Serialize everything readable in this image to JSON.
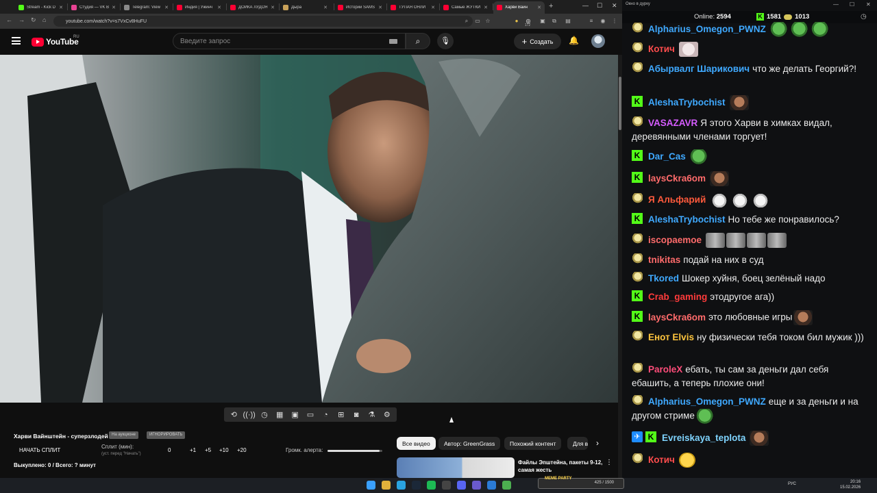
{
  "browser": {
    "tabs": [
      {
        "label": "Stream - Kick D",
        "icon": "kick-icon",
        "color": "#53fc18"
      },
      {
        "label": "Студия — VK B",
        "icon": "vk-icon",
        "color": "#e84393"
      },
      {
        "label": "Telegram: View",
        "icon": "telegram-icon",
        "color": "#8a8a8a"
      },
      {
        "label": "Индия | Ужинч",
        "icon": "youtube-icon",
        "color": "#ff0033"
      },
      {
        "label": "ДОЙКА ЛУДОЯ",
        "icon": "youtube-icon",
        "color": "#ff0033"
      },
      {
        "label": "Дыра",
        "icon": "page-icon",
        "color": "#c9a25a"
      },
      {
        "label": "Истории SAMS",
        "icon": "youtube-icon",
        "color": "#ff0033"
      },
      {
        "label": "ТУПАЯ ОНЛИ",
        "icon": "youtube-icon",
        "color": "#ff0033"
      },
      {
        "label": "Самые ЖУТКИ",
        "icon": "youtube-icon",
        "color": "#ff0033"
      },
      {
        "label": "Харви Вайн",
        "icon": "youtube-icon",
        "color": "#ff0033"
      }
    ],
    "url": "youtube.com/watch?v=s7VxCv8HuFU",
    "ext_badge_1": "172"
  },
  "youtube": {
    "logo_text": "YouTube",
    "country_code": "RU",
    "search_placeholder": "Введите запрос",
    "create_label": "Создать"
  },
  "player_controls": [
    "loop-icon",
    "broadcast-icon",
    "watch-later-icon",
    "clapper-icon",
    "miniplayer-icon",
    "theater-icon",
    "speed-icon",
    "add-screen-icon",
    "camera-icon",
    "flask-icon",
    "gear-icon"
  ],
  "splitter": {
    "title": "Харви Вайнштейн - суперзлодей",
    "badge_1": "На аукционе",
    "badge_2": "ИГНОРИРОВАТЬ",
    "start_split": "НАЧАТЬ СПЛИТ",
    "split_minutes": "Сплит (мин):",
    "split_note": "(уст. перед \"Начать\")",
    "value": "0",
    "steps": [
      "+1",
      "+5",
      "+10",
      "+20"
    ],
    "alert_volume_label": "Громк. алерта:",
    "alert_volume": 0.95,
    "bought": "Выкуплено: 0 / Всего: ? минут"
  },
  "chips": [
    "Все видео",
    "Автор: GreenGrass",
    "Похожий контент",
    "Для в"
  ],
  "recommendation": {
    "title": "Файлы Эпштейна, пакеты 9-12, самая жесть"
  },
  "chat": {
    "window_title": "Окно в дурку",
    "online_label": "Online:",
    "online_count": "2594",
    "kick_count": "1581",
    "coin_count": "1013",
    "messages": [
      {
        "badge": "coin",
        "user": "Alpharius_Omegon_PWNZ",
        "color": "#3fa9ff",
        "text": "",
        "emotes": [
          "frog",
          "frog",
          "frog"
        ]
      },
      {
        "badge": "coin",
        "user": "Котич",
        "color": "#ff4d4d",
        "text": "",
        "emotes": [
          "cat"
        ]
      },
      {
        "badge": "coin",
        "user": "Абырвалг Шарикович",
        "color": "#3fa9ff",
        "text": "что же делать Георгий?!",
        "emotes": []
      },
      {
        "badge": "kick",
        "user": "AleshaTrybochist",
        "color": "#3fa9ff",
        "text": "",
        "emotes": [
          "face"
        ]
      },
      {
        "badge": "coin",
        "user": "VASAZAVR",
        "color": "#d65cff",
        "text": "Я этого Харви в химках видал, деревянными членами торгует!",
        "emotes": []
      },
      {
        "badge": "kick",
        "user": "Dar_Cas",
        "color": "#3fa9ff",
        "text": "",
        "emotes": [
          "frog"
        ]
      },
      {
        "badge": "kick",
        "user": "laysCkra6om",
        "color": "#ff6b6b",
        "text": "",
        "emotes": [
          "face"
        ]
      },
      {
        "badge": "coin",
        "user": "Я Альфарий",
        "color": "#ff5a3c",
        "text": "",
        "emotes": [
          "sheep",
          "sheep",
          "sheep"
        ]
      },
      {
        "badge": "kick",
        "user": "AleshaTrybochist",
        "color": "#3fa9ff",
        "text": "Но тебе же понравилось?",
        "emotes": []
      },
      {
        "badge": "coin",
        "user": "iscopaemoe",
        "color": "#ff6b6b",
        "text": "",
        "emotes": [
          "wide",
          "wide",
          "wide",
          "wide"
        ]
      },
      {
        "badge": "coin",
        "user": "tnikitas",
        "color": "#ff6b6b",
        "text": "подай на них в суд",
        "emotes": []
      },
      {
        "badge": "coin",
        "user": "Tkored",
        "color": "#3fa9ff",
        "text": "Шокер хуйня, боец зелёный надо",
        "emotes": []
      },
      {
        "badge": "kick",
        "user": "Crab_gaming",
        "color": "#ff3b3b",
        "text": "этодругое ага))",
        "emotes": []
      },
      {
        "badge": "kick",
        "user": "laysCkra6om",
        "color": "#ff6b6b",
        "text": "это любовные игры",
        "emotes": [
          "face"
        ]
      },
      {
        "badge": "coin",
        "user": "Енот Elvis",
        "color": "#ffc53d",
        "text": "ну физически тебя током бил мужик )))",
        "emotes": []
      },
      {
        "badge": "coin",
        "user": "ParoleX",
        "color": "#ff4d7a",
        "text": "ебать, ты сам за деньги дал себя ебашить, а теперь плохие они!",
        "emotes": []
      },
      {
        "badge": "coin",
        "user": "Alpharius_Omegon_PWNZ",
        "color": "#3fa9ff",
        "text": "еще и за деньги и на другом стриме",
        "emotes": [
          "frog"
        ]
      },
      {
        "badge": "bluekick",
        "user": "Evreiskaya_teplota",
        "color": "#7fd4ff",
        "text": "",
        "emotes": [
          "face"
        ]
      },
      {
        "badge": "coin",
        "user": "Котич",
        "color": "#ff4d4d",
        "text": "",
        "emotes": [
          "smile"
        ]
      }
    ]
  },
  "taskbar": {
    "tray_text": "425 / 1500",
    "tray_tag": "MEME PARTY",
    "lang": "РУС",
    "time": "20:16",
    "date": "15.02.2026"
  },
  "colors": {
    "youtube_red": "#ff0033",
    "kick_green": "#53fc18",
    "bg": "#0f0f0f"
  }
}
